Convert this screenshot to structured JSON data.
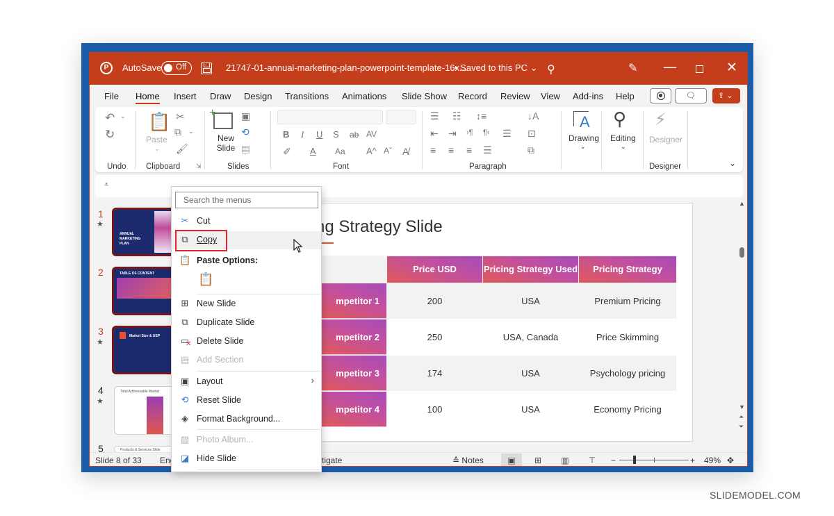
{
  "titlebar": {
    "app_icon": "powerpoint-logo-icon",
    "autosave_label": "AutoSave",
    "autosave_state": "Off",
    "doc_title": "21747-01-annual-marketing-plan-powerpoint-template-16x...",
    "save_status": "• Saved to this PC",
    "icons": [
      "save-icon",
      "search-icon",
      "pen-icon",
      "minimize-icon",
      "maximize-icon",
      "close-icon"
    ]
  },
  "menu_tabs": [
    "File",
    "Home",
    "Insert",
    "Draw",
    "Design",
    "Transitions",
    "Animations",
    "Slide Show",
    "Record",
    "Review",
    "View",
    "Add-ins",
    "Help"
  ],
  "active_tab": "Home",
  "ribbon": {
    "groups": [
      {
        "label": "Undo"
      },
      {
        "label": "Clipboard",
        "paste_label": "Paste"
      },
      {
        "label": "Slides",
        "new_slide_label": "New Slide"
      },
      {
        "label": "Font",
        "font_buttons": [
          "B",
          "I",
          "U",
          "S",
          "ab",
          "AV",
          "A",
          "Aa",
          "A^",
          "Aˇ"
        ]
      },
      {
        "label": "Paragraph"
      },
      {
        "label": "",
        "drawing_label": "Drawing",
        "editing_label": "Editing"
      },
      {
        "label": "Designer",
        "designer_label": "Designer"
      }
    ]
  },
  "thumbnails": [
    {
      "num": "1",
      "starred": true,
      "selected": true,
      "caption": "ANNUAL MARKETING PLAN"
    },
    {
      "num": "2",
      "starred": false,
      "selected": true,
      "caption": "TABLE OF CONTENT"
    },
    {
      "num": "3",
      "starred": true,
      "selected": true,
      "caption": "Market Size & USP"
    },
    {
      "num": "4",
      "starred": true,
      "selected": false,
      "caption": "Total Addressable Market"
    },
    {
      "num": "5",
      "starred": false,
      "selected": false,
      "caption": "Products & Services Slide"
    }
  ],
  "slide": {
    "title_visible": "ng Strategy Slide",
    "table": {
      "headers": [
        "",
        "Price USD",
        "Pricing Strategy Used",
        "Pricing Strategy"
      ],
      "rows": [
        [
          "mpetitor 1",
          "200",
          "USA",
          "Premium Pricing"
        ],
        [
          "mpetitor 2",
          "250",
          "USA, Canada",
          "Price Skimming"
        ],
        [
          "mpetitor 3",
          "174",
          "USA",
          "Psychology pricing"
        ],
        [
          "mpetitor 4",
          "100",
          "USA",
          "Economy Pricing"
        ]
      ]
    }
  },
  "context_menu": {
    "search_placeholder": "Search the menus",
    "items": [
      {
        "label": "Cut",
        "icon": "scissors-icon",
        "enabled": true
      },
      {
        "label": "Copy",
        "icon": "copy-icon",
        "enabled": true,
        "highlighted": true
      },
      {
        "label": "Paste Options:",
        "icon": "paste-icon",
        "enabled": true,
        "bold": true
      },
      {
        "label": "New Slide",
        "icon": "new-slide-icon",
        "enabled": true
      },
      {
        "label": "Duplicate Slide",
        "icon": "duplicate-slide-icon",
        "enabled": true
      },
      {
        "label": "Delete Slide",
        "icon": "delete-slide-icon",
        "enabled": true
      },
      {
        "label": "Add Section",
        "icon": "add-section-icon",
        "enabled": false
      },
      {
        "label": "Layout",
        "icon": "layout-icon",
        "enabled": true,
        "submenu": true
      },
      {
        "label": "Reset Slide",
        "icon": "reset-slide-icon",
        "enabled": true
      },
      {
        "label": "Format Background...",
        "icon": "format-background-icon",
        "enabled": true
      },
      {
        "label": "Photo Album...",
        "icon": "photo-album-icon",
        "enabled": false
      },
      {
        "label": "Hide Slide",
        "icon": "hide-slide-icon",
        "enabled": true
      }
    ]
  },
  "statusbar": {
    "slide_info": "Slide 8 of 33",
    "language_partial": "Eng",
    "accessibility_partial": "stigate",
    "notes_label": "Notes",
    "zoom_minus": "−",
    "zoom_plus": "+",
    "zoom_level": "49%",
    "zoom_slider_fraction": 0.49
  },
  "watermark": "SLIDEMODEL.COM",
  "colors": {
    "accent": "#c43e1c",
    "frame_blue": "#1a5ca8",
    "copy_highlight": "#e8222d",
    "table_gradient_start": "#e05a5a",
    "table_gradient_end": "#a54cb8"
  }
}
